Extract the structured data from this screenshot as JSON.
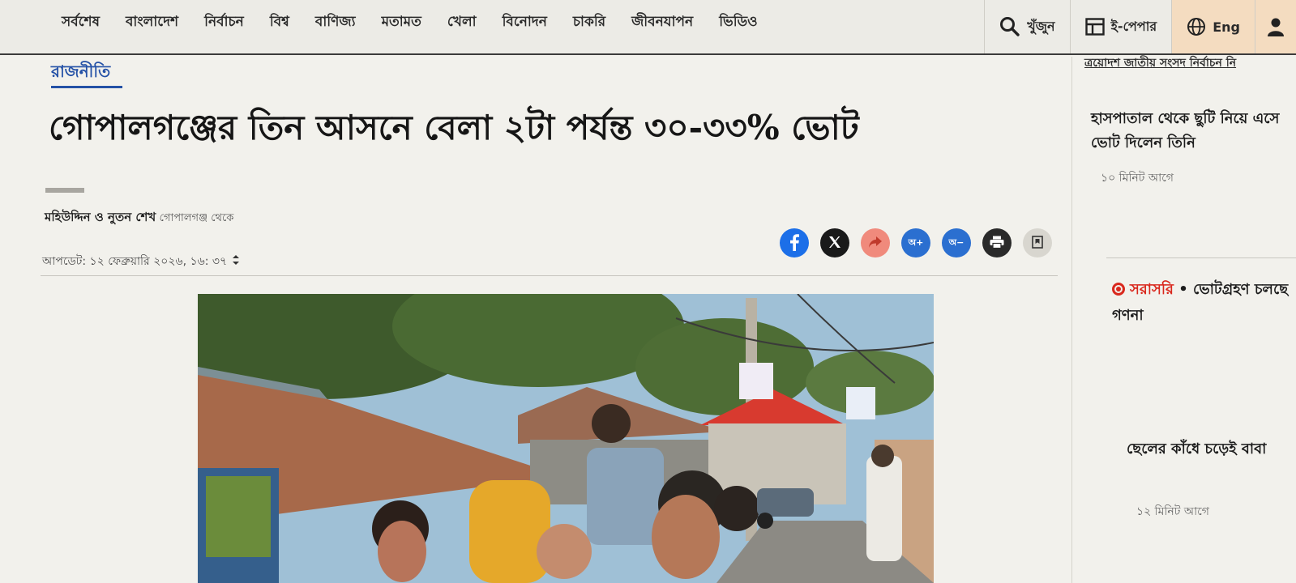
{
  "nav": {
    "items": [
      "সর্বশেষ",
      "বাংলাদেশ",
      "নির্বাচন",
      "বিশ্ব",
      "বাণিজ্য",
      "মতামত",
      "খেলা",
      "বিনোদন",
      "চাকরি",
      "জীবনযাপন",
      "ভিডিও"
    ],
    "search_label": "খুঁজুন",
    "epaper_label": "ই-পেপার",
    "lang_label": "Eng"
  },
  "article": {
    "section": "রাজনীতি",
    "headline": "গোপালগঞ্জের তিন আসনে বেলা ২টা পর্যন্ত ৩০-৩৩% ভোট",
    "author": "মহিউদ্দিন ও নুতন শেখ",
    "place": "গোপালগঞ্জ থেকে",
    "updated": "আপডেট: ১২ ফেব্রুয়ারি ২০২৬, ১৬: ৩৭",
    "share": {
      "font_up": "অ+",
      "font_down": "অ−"
    }
  },
  "sidebar": {
    "topic": "ত্রয়োদশ জাতীয় সংসদ নির্বাচন নি",
    "stories": [
      {
        "title": "হাসপাতাল থেকে ছুটি নিয়ে এসে ভোট দিলেন তিনি",
        "time": "১০ মিনিট আগে"
      },
      {
        "title": "ছেলের কাঁধে চড়েই বাবা",
        "time": "১২ মিনিট আগে"
      }
    ],
    "live": {
      "tag": "সরাসরি",
      "separator": " • ",
      "text": "ভোটগ্রহণ চলছে গণনা"
    }
  },
  "colors": {
    "accent": "#2451a6",
    "live": "#d9281d",
    "facebook": "#1c6fe8",
    "lang_bg": "#f4dcc0"
  }
}
